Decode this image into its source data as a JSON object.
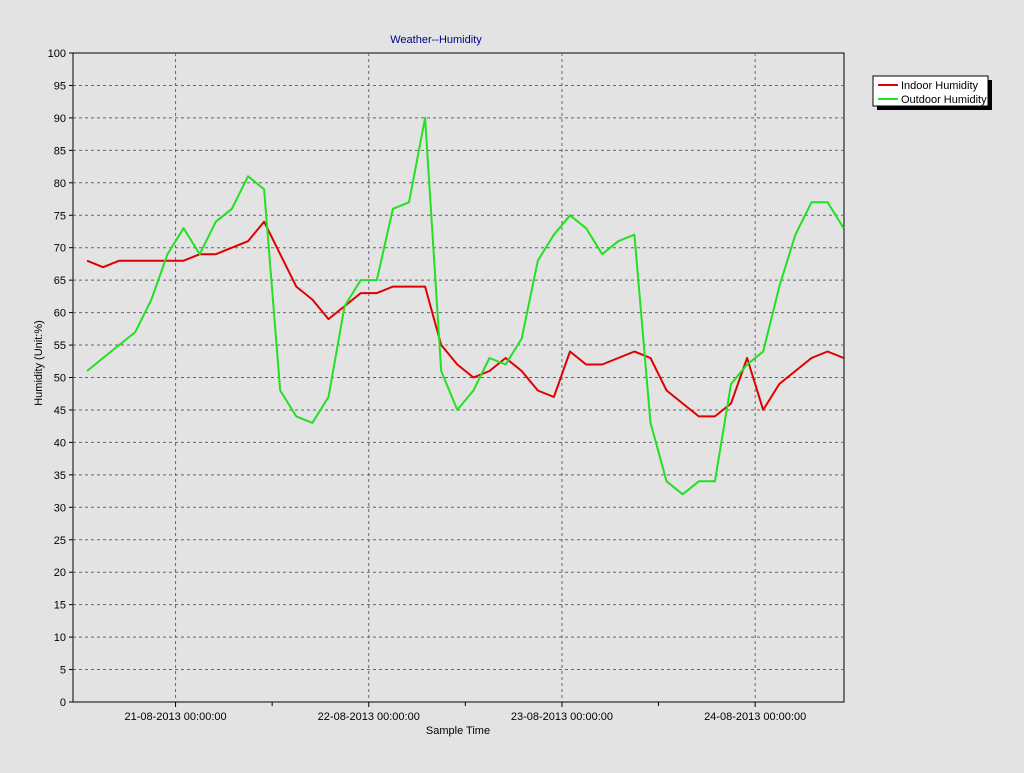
{
  "chart_data": {
    "type": "line",
    "title": "Weather--Humidity",
    "xlabel": "Sample Time",
    "ylabel": "Humidity (Unit:%)",
    "ylim": [
      0,
      100
    ],
    "ytick_step": 5,
    "grid": true,
    "legend_position": "top-right",
    "x_tick_labels": [
      "21-08-2013 00:00:00",
      "22-08-2013 00:00:00",
      "23-08-2013 00:00:00",
      "24-08-2013 00:00:00"
    ],
    "x_major_tick_index": [
      5.5,
      17.5,
      29.5,
      41.5
    ],
    "x_minor_tick_index": [
      11.5,
      23.5,
      35.5
    ],
    "series": [
      {
        "name": "Indoor Humidity",
        "color": "#e00000",
        "values": [
          68,
          67,
          68,
          68,
          68,
          68,
          68,
          69,
          69,
          70,
          71,
          74,
          69,
          64,
          62,
          59,
          61,
          63,
          63,
          64,
          64,
          64,
          55,
          52,
          50,
          51,
          53,
          51,
          48,
          47,
          54,
          52,
          52,
          53,
          54,
          53,
          48,
          46,
          44,
          44,
          46,
          53,
          45,
          49,
          51,
          53,
          54,
          53
        ]
      },
      {
        "name": "Outdoor Humidity",
        "color": "#22e022",
        "values": [
          51,
          53,
          55,
          57,
          62,
          69,
          73,
          69,
          74,
          76,
          81,
          79,
          48,
          44,
          43,
          47,
          61,
          65,
          65,
          76,
          77,
          90,
          51,
          45,
          48,
          53,
          52,
          56,
          68,
          72,
          75,
          73,
          69,
          71,
          72,
          43,
          34,
          32,
          34,
          34,
          49,
          52,
          54,
          64,
          72,
          77,
          77,
          73
        ]
      }
    ]
  }
}
